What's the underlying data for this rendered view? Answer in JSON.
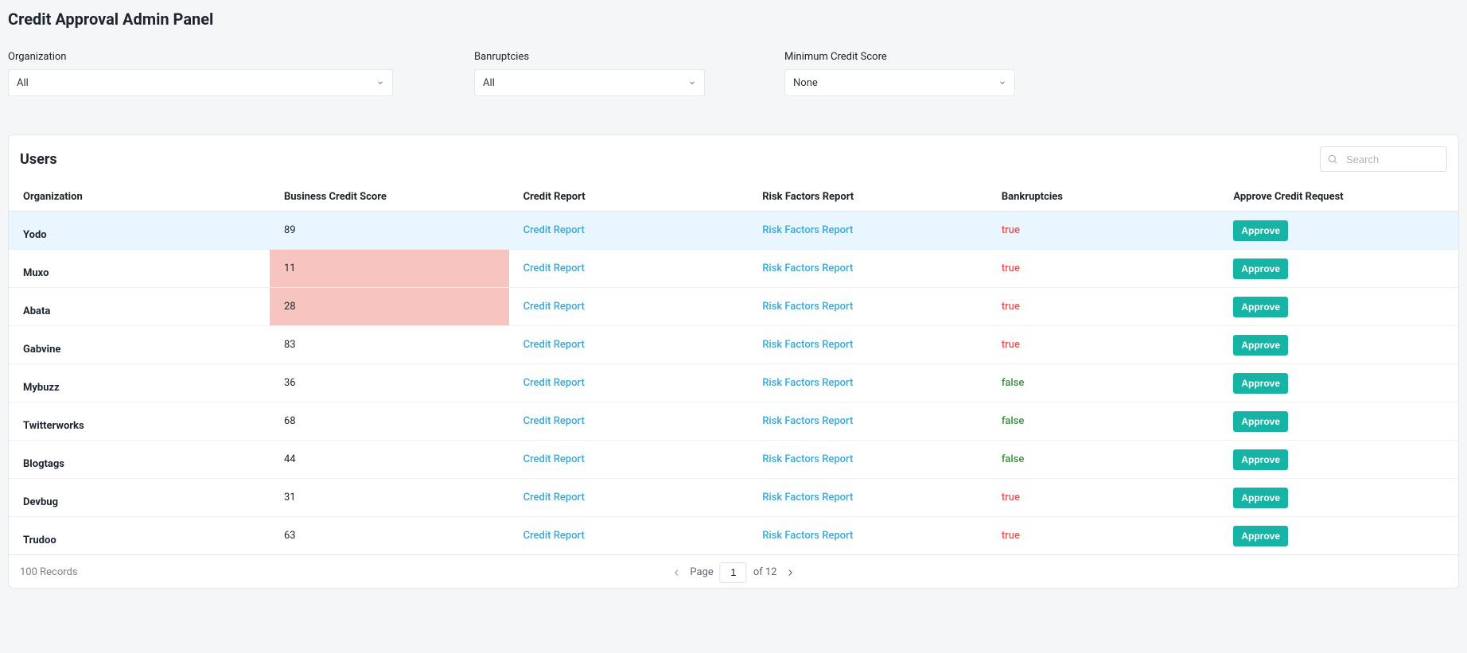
{
  "page": {
    "title": "Credit Approval Admin Panel"
  },
  "filters": {
    "organization": {
      "label": "Organization",
      "value": "All"
    },
    "bankruptcies": {
      "label": "Banruptcies",
      "value": "All"
    },
    "min_credit": {
      "label": "Minimum Credit Score",
      "value": "None"
    }
  },
  "users_panel": {
    "title": "Users",
    "search_placeholder": "Search",
    "columns": {
      "organization": "Organization",
      "score": "Business Credit Score",
      "credit_report": "Credit Report",
      "risk_report": "Risk Factors Report",
      "bankruptcies": "Bankruptcies",
      "approve": "Approve Credit Request"
    },
    "link_labels": {
      "credit_report": "Credit Report",
      "risk_report": "Risk Factors Report"
    },
    "approve_label": "Approve",
    "highlighted_row_index": 0,
    "low_score_threshold": 30,
    "rows": [
      {
        "org": "Yodo",
        "score": 89,
        "bankruptcies": true
      },
      {
        "org": "Muxo",
        "score": 11,
        "bankruptcies": true
      },
      {
        "org": "Abata",
        "score": 28,
        "bankruptcies": true
      },
      {
        "org": "Gabvine",
        "score": 83,
        "bankruptcies": true
      },
      {
        "org": "Mybuzz",
        "score": 36,
        "bankruptcies": false
      },
      {
        "org": "Twitterworks",
        "score": 68,
        "bankruptcies": false
      },
      {
        "org": "Blogtags",
        "score": 44,
        "bankruptcies": false
      },
      {
        "org": "Devbug",
        "score": 31,
        "bankruptcies": true
      },
      {
        "org": "Trudoo",
        "score": 63,
        "bankruptcies": true
      }
    ]
  },
  "footer": {
    "records_label": "100 Records",
    "page_label": "Page",
    "current_page": "1",
    "of_label": "of 12"
  }
}
